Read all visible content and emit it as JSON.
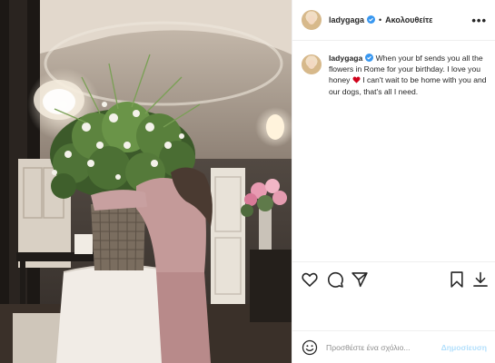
{
  "post": {
    "username": "ladygaga",
    "follow_label": "Ακολουθείτε",
    "separator": "•",
    "more_glyph": "•••",
    "caption_username": "ladygaga",
    "caption_text_before_emoji": " When your bf sends you all the flowers in Rome for your birthday. I love you honey ",
    "caption_text_after_emoji": " I can't wait to be home with you and our dogs, that's all I need."
  },
  "comment": {
    "placeholder": "Προσθέστε ένα σχόλιο...",
    "post_label": "Δημοσίευση"
  },
  "icons": {
    "verified": "verified-badge-icon",
    "heart_emoji": "red-heart-emoji",
    "like": "heart-outline-icon",
    "comment": "comment-bubble-icon",
    "share": "paper-plane-icon",
    "save": "bookmark-icon",
    "download": "download-icon",
    "emoji": "smiley-icon"
  },
  "colors": {
    "text": "#262626",
    "verified_blue": "#3897f0",
    "post_button_disabled": "#b2dffc",
    "placeholder": "#8e8e8e",
    "heart_red": "#d0021b"
  }
}
